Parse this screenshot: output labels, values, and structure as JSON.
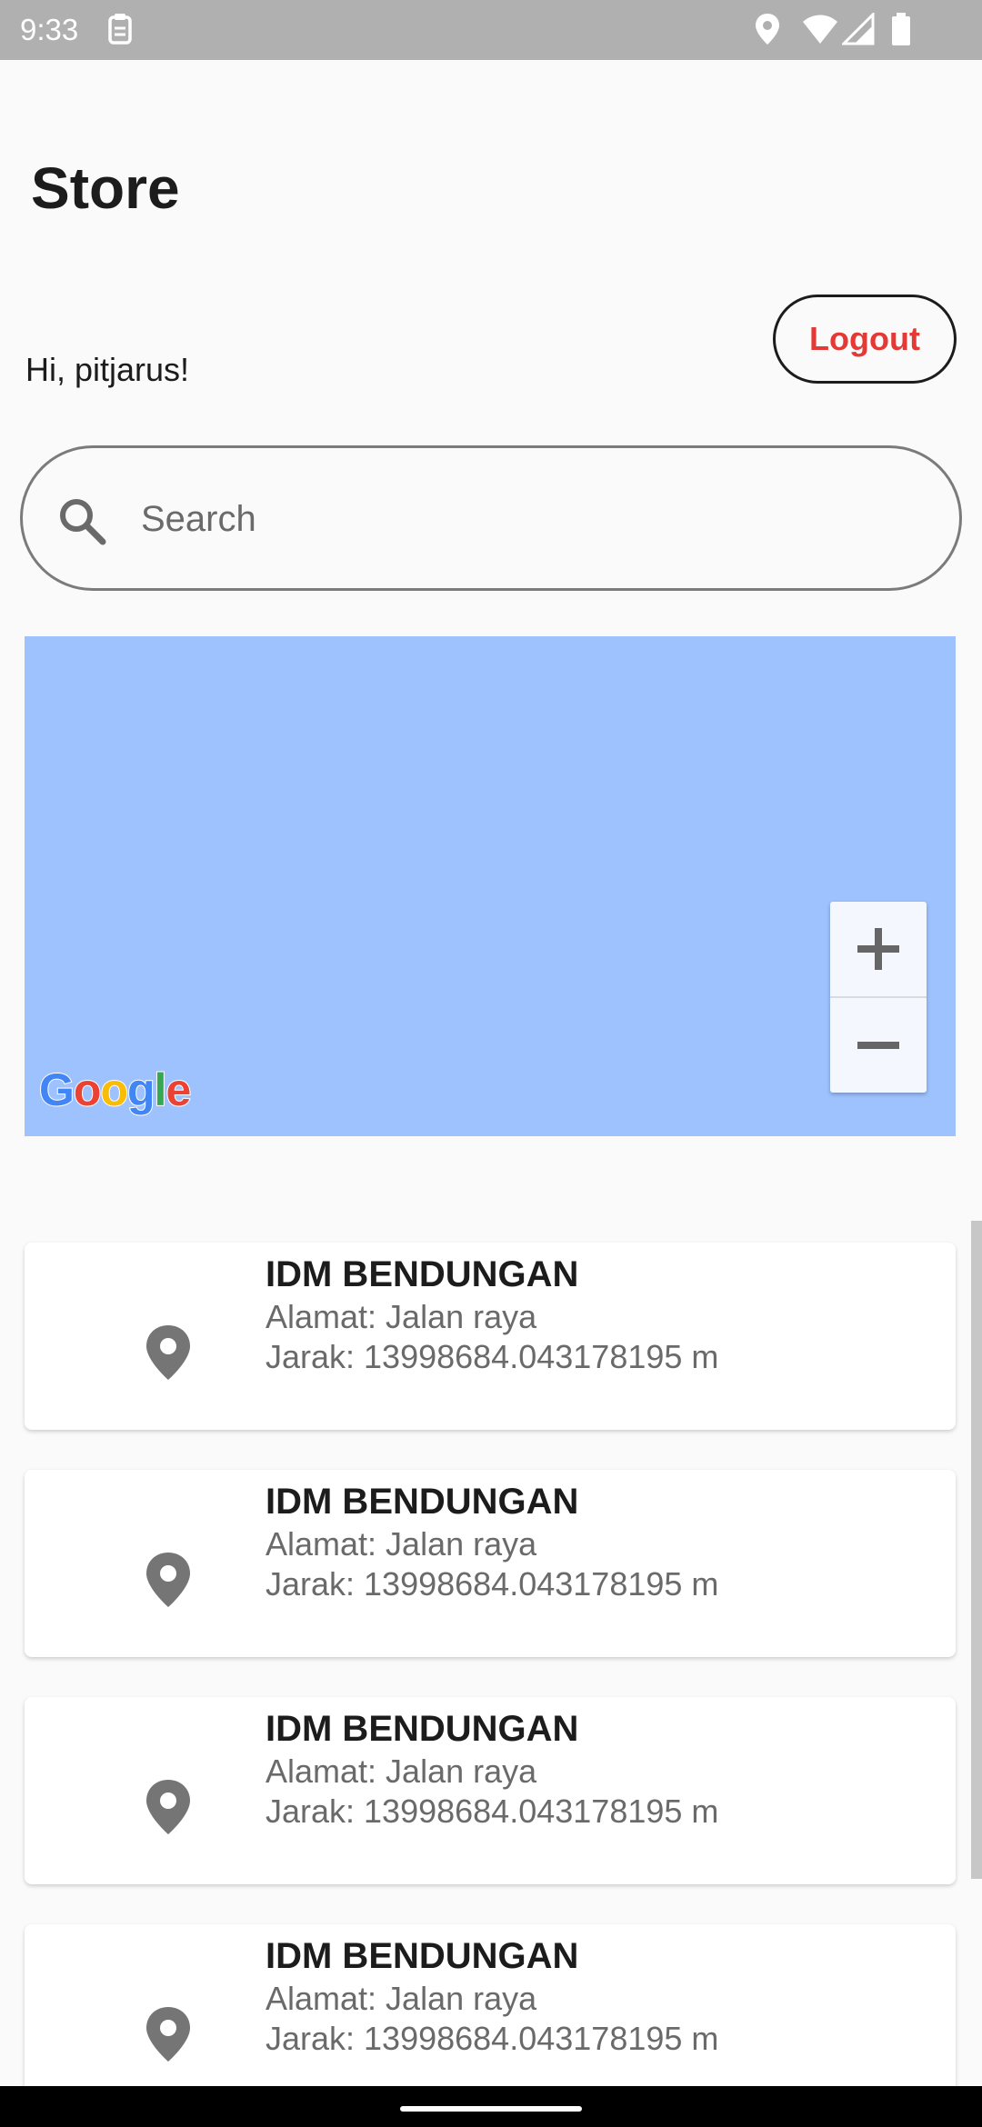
{
  "status_bar": {
    "time": "9:33"
  },
  "header": {
    "title": "Store",
    "greeting": "Hi, pitjarus!",
    "logout_label": "Logout"
  },
  "search": {
    "placeholder": "Search",
    "value": ""
  },
  "map": {
    "provider_logo": "Google",
    "zoom_in_label": "+",
    "zoom_out_label": "−",
    "background_color": "#9ec2fd"
  },
  "stores": [
    {
      "name": "IDM BENDUNGAN",
      "address": "Alamat: Jalan raya",
      "distance": "Jarak: 13998684.043178195 m"
    },
    {
      "name": "IDM BENDUNGAN",
      "address": "Alamat: Jalan raya",
      "distance": "Jarak: 13998684.043178195 m"
    },
    {
      "name": "IDM BENDUNGAN",
      "address": "Alamat: Jalan raya",
      "distance": "Jarak: 13998684.043178195 m"
    },
    {
      "name": "IDM BENDUNGAN",
      "address": "Alamat: Jalan raya",
      "distance": "Jarak: 13998684.043178195 m"
    }
  ],
  "colors": {
    "accent": "#e53935",
    "status_bar": "#b0b0b0",
    "text": "#1c1c1c",
    "secondary_text": "#6a6a6a"
  },
  "icons": [
    "clipboard-icon",
    "location-icon",
    "wifi-icon",
    "signal-icon",
    "battery-icon",
    "search-icon",
    "pin-icon"
  ]
}
